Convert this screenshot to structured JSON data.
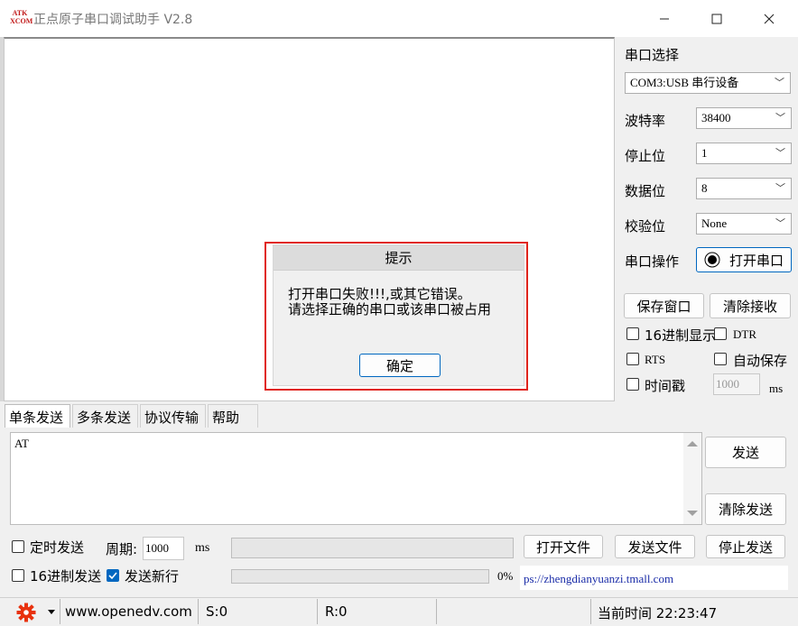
{
  "window": {
    "logo_text": "ATK XCOM",
    "title": "正点原子串口调试助手 V2.8",
    "minimize_icon": "minimize-icon",
    "maximize_icon": "maximize-icon",
    "close_icon": "close-icon"
  },
  "settings": {
    "port_select_label": "串口选择",
    "port_value": "COM3:USB 串行设备",
    "baud_label": "波特率",
    "baud_value": "38400",
    "stop_label": "停止位",
    "stop_value": "1",
    "data_label": "数据位",
    "data_value": "8",
    "parity_label": "校验位",
    "parity_value": "None",
    "port_op_label": "串口操作",
    "open_port_label": "打开串口",
    "save_window_label": "保存窗口",
    "clear_receive_label": "清除接收",
    "hex_display_label": "16进制显示",
    "dtr_label": "DTR",
    "rts_label": "RTS",
    "auto_save_label": "自动保存",
    "timestamp_label": "时间戳",
    "timestamp_value": "1000",
    "timestamp_unit": "ms"
  },
  "tabs": [
    "单条发送",
    "多条发送",
    "协议传输",
    "帮助"
  ],
  "send": {
    "text": "AT",
    "send_label": "发送",
    "clear_send_label": "清除发送",
    "timed_send_label": "定时发送",
    "period_label": "周期:",
    "period_value": "1000",
    "period_unit": "ms",
    "open_file_label": "打开文件",
    "send_file_label": "发送文件",
    "stop_send_label": "停止发送",
    "hex_send_label": "16进制发送",
    "send_newline_label": "发送新行",
    "progress_text": "0%",
    "progress": 0,
    "link_text": "ps://zhengdianyuanzi.tmall.com"
  },
  "status": {
    "website": "www.openedv.com",
    "sent": "S:0",
    "received": "R:0",
    "time": "当前时间 22:23:47"
  },
  "dialog": {
    "title": "提示",
    "message_line1": "打开串口失败!!!,或其它错误。",
    "message_line2": "请选择正确的串口或该串口被占用",
    "ok_label": "确定"
  },
  "colors": {
    "accent": "#0067c0",
    "highlight_frame": "#e0241c",
    "gear": "#e8320e"
  }
}
